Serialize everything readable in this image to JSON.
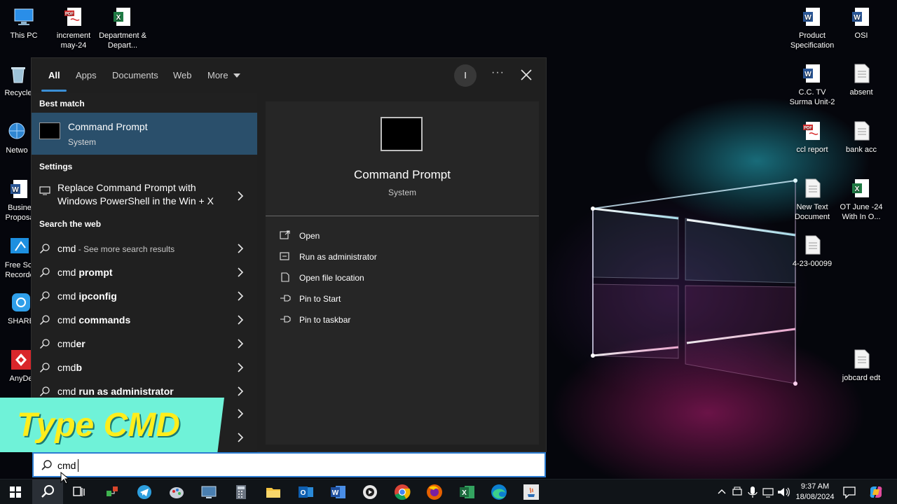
{
  "search_panel": {
    "tabs": [
      {
        "label": "All"
      },
      {
        "label": "Apps"
      },
      {
        "label": "Documents"
      },
      {
        "label": "Web"
      },
      {
        "label": "More"
      }
    ],
    "user_initial": "I",
    "more_options": "···",
    "sections": {
      "best_match": "Best match",
      "settings": "Settings",
      "search_web": "Search the web"
    },
    "best_match": {
      "name": "Command Prompt",
      "subtitle": "System"
    },
    "settings_item": {
      "line1": "Replace Command Prompt with",
      "line2": "Windows PowerShell in the Win + X"
    },
    "web_results": [
      {
        "prefix": "cmd",
        "suffix": "",
        "muted": " - See more search results"
      },
      {
        "prefix": "cmd ",
        "suffix": "prompt",
        "muted": ""
      },
      {
        "prefix": "cmd ",
        "suffix": "ipconfig",
        "muted": ""
      },
      {
        "prefix": "cmd ",
        "suffix": "commands",
        "muted": ""
      },
      {
        "prefix": "cmd",
        "suffix": "er",
        "muted": ""
      },
      {
        "prefix": "cmd",
        "suffix": "b",
        "muted": ""
      },
      {
        "prefix": "cmd ",
        "suffix": "run as administrator",
        "muted": ""
      }
    ],
    "detail": {
      "name": "Command Prompt",
      "subtitle": "System",
      "actions": [
        {
          "label": "Open",
          "icon": "open-icon"
        },
        {
          "label": "Run as administrator",
          "icon": "shield-icon"
        },
        {
          "label": "Open file location",
          "icon": "file-icon"
        },
        {
          "label": "Pin to Start",
          "icon": "pin-icon"
        },
        {
          "label": "Pin to taskbar",
          "icon": "pin-icon"
        }
      ]
    },
    "search_value": "cmd"
  },
  "overlay_caption": "Type CMD",
  "desktop_icons": {
    "left": [
      {
        "label": "This PC"
      },
      {
        "label": "Recycle"
      },
      {
        "label": "Netwo"
      },
      {
        "label": "Busine Proposa"
      },
      {
        "label": "Free Scr Recorde"
      },
      {
        "label": "SHARE"
      },
      {
        "label": "AnyDe"
      }
    ],
    "top": [
      {
        "label": "increment may-24"
      },
      {
        "label": "Department & Depart..."
      }
    ],
    "right": [
      {
        "label": "Product Specification"
      },
      {
        "label": "OSI"
      },
      {
        "label": "C.C. TV Surma Unit-2"
      },
      {
        "label": "absent"
      },
      {
        "label": "ccl report"
      },
      {
        "label": "bank acc"
      },
      {
        "label": "New Text Document"
      },
      {
        "label": "OT June -24 With In O..."
      },
      {
        "label": "4-23-00099"
      },
      {
        "label": "jobcard edt"
      }
    ]
  },
  "taskbar": {
    "time": "9:37 AM",
    "date": "18/08/2024"
  },
  "colors": {
    "accent": "#3b8fd6",
    "best_match_bg": "#2a4f6b",
    "banner": "#6ff2d8",
    "banner_text": "#ffee1c"
  }
}
